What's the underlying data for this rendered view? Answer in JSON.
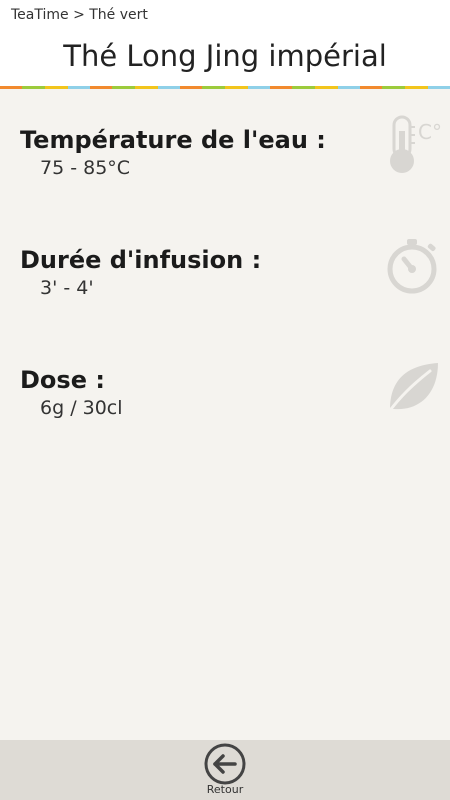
{
  "header": {
    "breadcrumb": "TeaTime > Thé vert",
    "title": "Thé Long Jing impérial"
  },
  "sections": [
    {
      "label": "Température de l'eau :",
      "value": "75 - 85°C",
      "icon": "thermometer-icon",
      "icon_text": "C°"
    },
    {
      "label": "Durée d'infusion :",
      "value": "3' - 4'",
      "icon": "stopwatch-icon"
    },
    {
      "label": "Dose :",
      "value": "6g / 30cl",
      "icon": "leaf-icon"
    }
  ],
  "footer": {
    "back_label": "Retour",
    "back_icon": "back-arrow-icon"
  },
  "colors": {
    "background": "#f5f3ef",
    "header_bg": "#ffffff",
    "footer_bg": "#dedbd5",
    "icon_gray": "#d8d6d2",
    "strip": [
      "#f28a2e",
      "#9ccb3c",
      "#f2c51c",
      "#8fd0e8"
    ]
  }
}
